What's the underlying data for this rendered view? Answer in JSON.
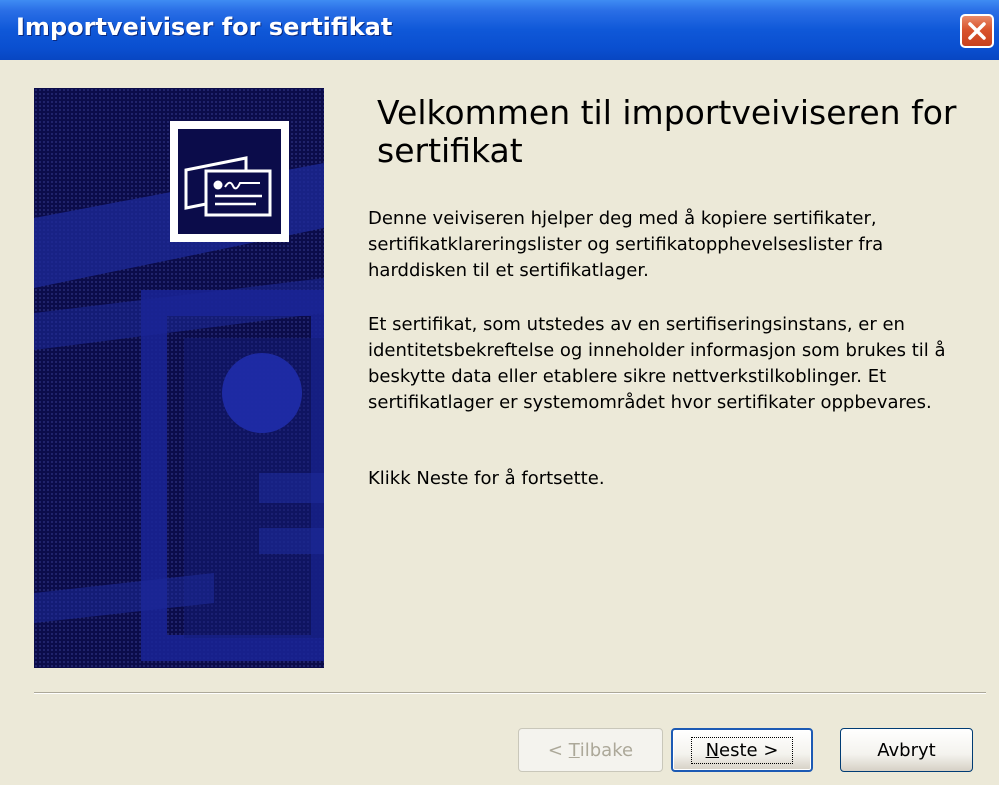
{
  "window": {
    "title": "Importveiviser for sertifikat",
    "titlebar_color": "#0a4fd0"
  },
  "side_panel": {
    "icon": "certificate-icon",
    "background_color": "#0b0c4a"
  },
  "content": {
    "heading": "Velkommen til importveiviseren for sertifikat",
    "paragraph1": "Denne veiviseren hjelper deg med å kopiere sertifikater, sertifikatklareringslister og sertifikatopphevelseslister fra harddisken til et sertifikatlager.",
    "paragraph2": "Et sertifikat, som utstedes av en sertifiseringsinstans, er en identitetsbekreftelse og inneholder informasjon som brukes til å beskytte data eller etablere sikre nettverkstilkoblinger. Et sertifikatlager er systemområdet hvor sertifikater oppbevares.",
    "paragraph3": "Klikk Neste for å fortsette."
  },
  "buttons": {
    "back": {
      "prefix": "< ",
      "mnemonic": "T",
      "rest": "ilbake",
      "enabled": false
    },
    "next": {
      "mnemonic": "N",
      "rest": "este >",
      "enabled": true,
      "default": true
    },
    "cancel": {
      "label": "Avbryt",
      "enabled": true
    }
  }
}
